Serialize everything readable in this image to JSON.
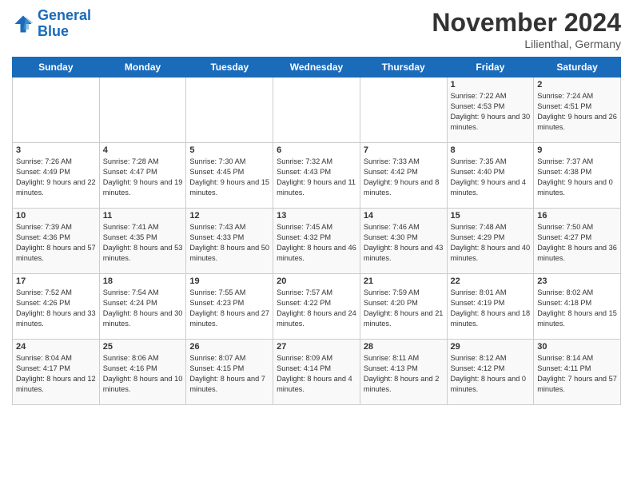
{
  "header": {
    "logo_line1": "General",
    "logo_line2": "Blue",
    "month": "November 2024",
    "location": "Lilienthal, Germany"
  },
  "days_of_week": [
    "Sunday",
    "Monday",
    "Tuesday",
    "Wednesday",
    "Thursday",
    "Friday",
    "Saturday"
  ],
  "weeks": [
    [
      {
        "day": "",
        "info": ""
      },
      {
        "day": "",
        "info": ""
      },
      {
        "day": "",
        "info": ""
      },
      {
        "day": "",
        "info": ""
      },
      {
        "day": "",
        "info": ""
      },
      {
        "day": "1",
        "info": "Sunrise: 7:22 AM\nSunset: 4:53 PM\nDaylight: 9 hours and 30 minutes."
      },
      {
        "day": "2",
        "info": "Sunrise: 7:24 AM\nSunset: 4:51 PM\nDaylight: 9 hours and 26 minutes."
      }
    ],
    [
      {
        "day": "3",
        "info": "Sunrise: 7:26 AM\nSunset: 4:49 PM\nDaylight: 9 hours and 22 minutes."
      },
      {
        "day": "4",
        "info": "Sunrise: 7:28 AM\nSunset: 4:47 PM\nDaylight: 9 hours and 19 minutes."
      },
      {
        "day": "5",
        "info": "Sunrise: 7:30 AM\nSunset: 4:45 PM\nDaylight: 9 hours and 15 minutes."
      },
      {
        "day": "6",
        "info": "Sunrise: 7:32 AM\nSunset: 4:43 PM\nDaylight: 9 hours and 11 minutes."
      },
      {
        "day": "7",
        "info": "Sunrise: 7:33 AM\nSunset: 4:42 PM\nDaylight: 9 hours and 8 minutes."
      },
      {
        "day": "8",
        "info": "Sunrise: 7:35 AM\nSunset: 4:40 PM\nDaylight: 9 hours and 4 minutes."
      },
      {
        "day": "9",
        "info": "Sunrise: 7:37 AM\nSunset: 4:38 PM\nDaylight: 9 hours and 0 minutes."
      }
    ],
    [
      {
        "day": "10",
        "info": "Sunrise: 7:39 AM\nSunset: 4:36 PM\nDaylight: 8 hours and 57 minutes."
      },
      {
        "day": "11",
        "info": "Sunrise: 7:41 AM\nSunset: 4:35 PM\nDaylight: 8 hours and 53 minutes."
      },
      {
        "day": "12",
        "info": "Sunrise: 7:43 AM\nSunset: 4:33 PM\nDaylight: 8 hours and 50 minutes."
      },
      {
        "day": "13",
        "info": "Sunrise: 7:45 AM\nSunset: 4:32 PM\nDaylight: 8 hours and 46 minutes."
      },
      {
        "day": "14",
        "info": "Sunrise: 7:46 AM\nSunset: 4:30 PM\nDaylight: 8 hours and 43 minutes."
      },
      {
        "day": "15",
        "info": "Sunrise: 7:48 AM\nSunset: 4:29 PM\nDaylight: 8 hours and 40 minutes."
      },
      {
        "day": "16",
        "info": "Sunrise: 7:50 AM\nSunset: 4:27 PM\nDaylight: 8 hours and 36 minutes."
      }
    ],
    [
      {
        "day": "17",
        "info": "Sunrise: 7:52 AM\nSunset: 4:26 PM\nDaylight: 8 hours and 33 minutes."
      },
      {
        "day": "18",
        "info": "Sunrise: 7:54 AM\nSunset: 4:24 PM\nDaylight: 8 hours and 30 minutes."
      },
      {
        "day": "19",
        "info": "Sunrise: 7:55 AM\nSunset: 4:23 PM\nDaylight: 8 hours and 27 minutes."
      },
      {
        "day": "20",
        "info": "Sunrise: 7:57 AM\nSunset: 4:22 PM\nDaylight: 8 hours and 24 minutes."
      },
      {
        "day": "21",
        "info": "Sunrise: 7:59 AM\nSunset: 4:20 PM\nDaylight: 8 hours and 21 minutes."
      },
      {
        "day": "22",
        "info": "Sunrise: 8:01 AM\nSunset: 4:19 PM\nDaylight: 8 hours and 18 minutes."
      },
      {
        "day": "23",
        "info": "Sunrise: 8:02 AM\nSunset: 4:18 PM\nDaylight: 8 hours and 15 minutes."
      }
    ],
    [
      {
        "day": "24",
        "info": "Sunrise: 8:04 AM\nSunset: 4:17 PM\nDaylight: 8 hours and 12 minutes."
      },
      {
        "day": "25",
        "info": "Sunrise: 8:06 AM\nSunset: 4:16 PM\nDaylight: 8 hours and 10 minutes."
      },
      {
        "day": "26",
        "info": "Sunrise: 8:07 AM\nSunset: 4:15 PM\nDaylight: 8 hours and 7 minutes."
      },
      {
        "day": "27",
        "info": "Sunrise: 8:09 AM\nSunset: 4:14 PM\nDaylight: 8 hours and 4 minutes."
      },
      {
        "day": "28",
        "info": "Sunrise: 8:11 AM\nSunset: 4:13 PM\nDaylight: 8 hours and 2 minutes."
      },
      {
        "day": "29",
        "info": "Sunrise: 8:12 AM\nSunset: 4:12 PM\nDaylight: 8 hours and 0 minutes."
      },
      {
        "day": "30",
        "info": "Sunrise: 8:14 AM\nSunset: 4:11 PM\nDaylight: 7 hours and 57 minutes."
      }
    ]
  ]
}
